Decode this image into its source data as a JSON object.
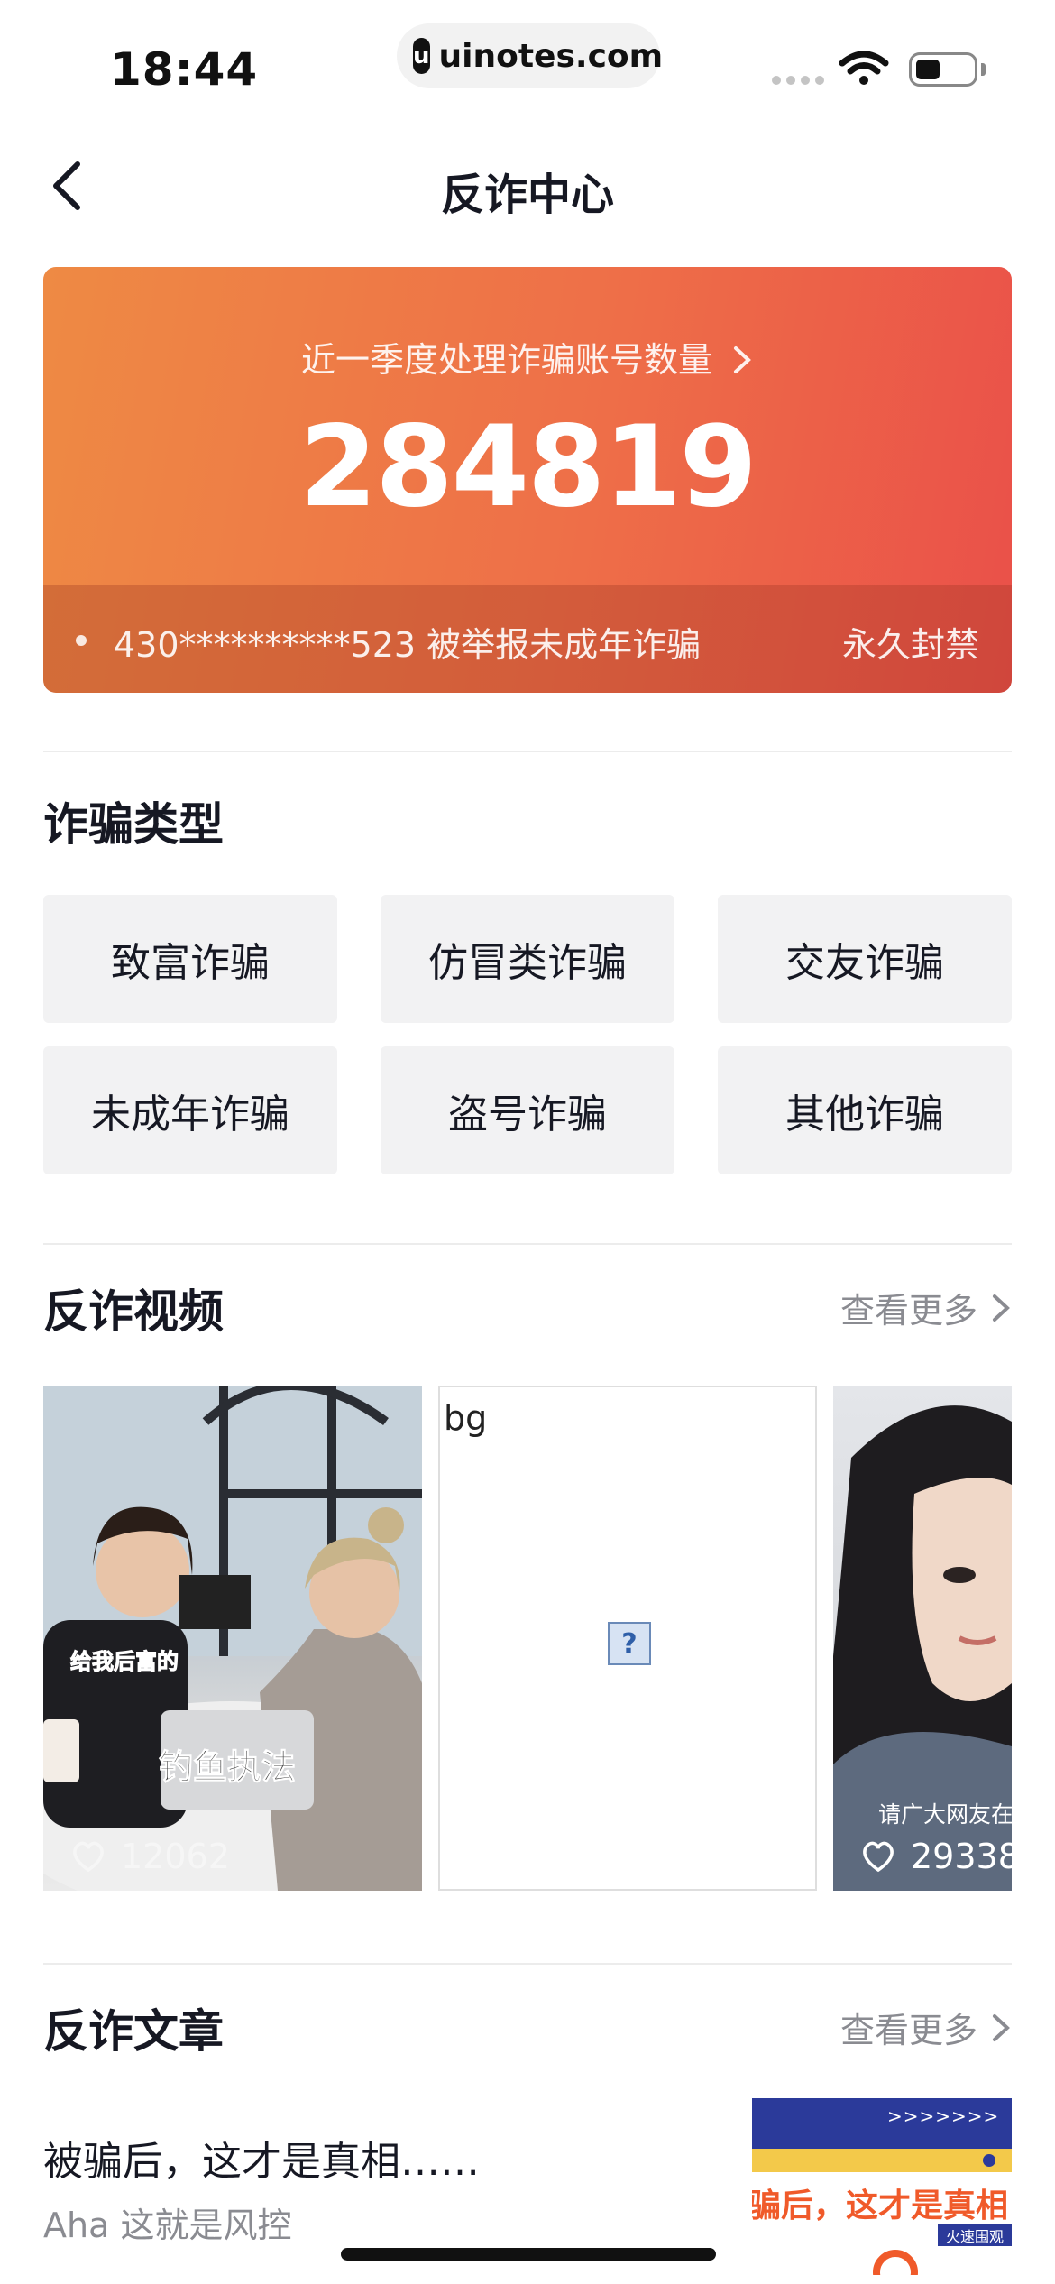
{
  "status_bar": {
    "time": "18:44",
    "url": "uinotes.com"
  },
  "nav": {
    "title": "反诈中心"
  },
  "hero": {
    "label": "近一季度处理诈骗账号数量",
    "count": "284819",
    "ticker_text": "430**********523 被举报未成年诈骗",
    "ticker_status": "永久封禁"
  },
  "fraud_types": {
    "title": "诈骗类型",
    "items": [
      "致富诈骗",
      "仿冒类诈骗",
      "交友诈骗",
      "未成年诈骗",
      "盗号诈骗",
      "其他诈骗"
    ]
  },
  "videos": {
    "title": "反诈视频",
    "see_more": "查看更多",
    "items": [
      {
        "caption_1": "给我后富的",
        "caption_2": "钓鱼执法",
        "likes": "12062"
      },
      {
        "alt": "bg",
        "missing_icon": "?"
      },
      {
        "caption": "请广大网友在",
        "likes": "29338"
      }
    ]
  },
  "articles": {
    "title": "反诈文章",
    "see_more": "查看更多",
    "items": [
      {
        "title": "被骗后，这才是真相……",
        "source": "Aha 这就是风控",
        "thumb_headline": "骗后，这才是真相",
        "thumb_tag": "火速围观",
        "thumb_arrows": ">>>>>>>"
      }
    ]
  },
  "colors": {
    "hero_start": "#ee8a44",
    "hero_end": "#ea5049",
    "accent": "#f0793c"
  }
}
